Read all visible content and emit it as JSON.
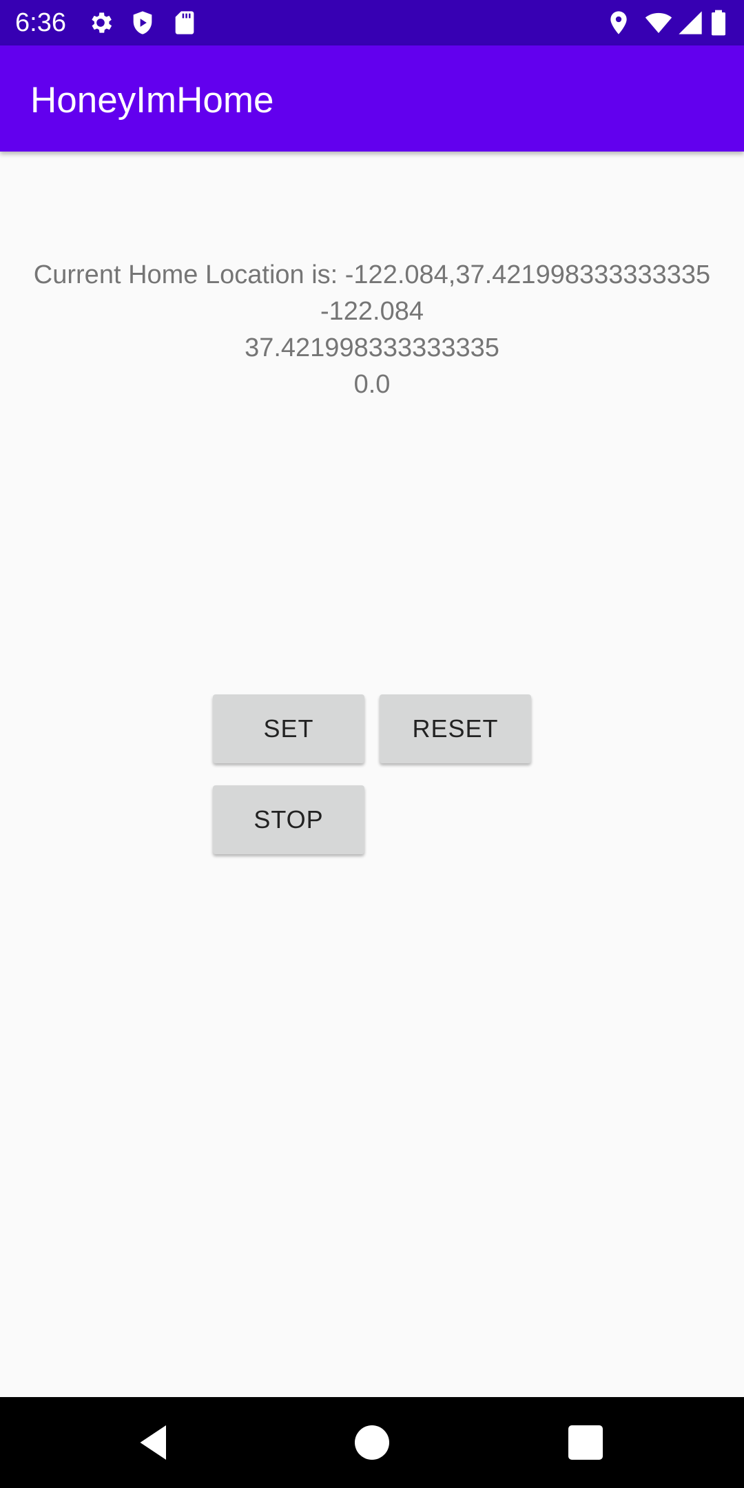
{
  "status_bar": {
    "time": "6:36",
    "left_icons": [
      "gear-icon",
      "shield-play-icon",
      "sd-card-icon"
    ],
    "right_icons": [
      "location-pin-icon",
      "wifi-icon",
      "cell-signal-icon",
      "battery-icon"
    ]
  },
  "app_bar": {
    "title": "HoneyImHome",
    "color": "#6200ee",
    "status_color": "#3700b3"
  },
  "location": {
    "line1": "Current Home Location is:  -122.084,37.421998333333335",
    "longitude": "-122.084",
    "latitude": "37.421998333333335",
    "third_value": "0.0"
  },
  "buttons": {
    "set_label": "SET",
    "reset_label": "RESET",
    "stop_label": "STOP"
  },
  "nav_bar": {
    "icons": [
      "back-icon",
      "home-icon",
      "recents-icon"
    ]
  }
}
